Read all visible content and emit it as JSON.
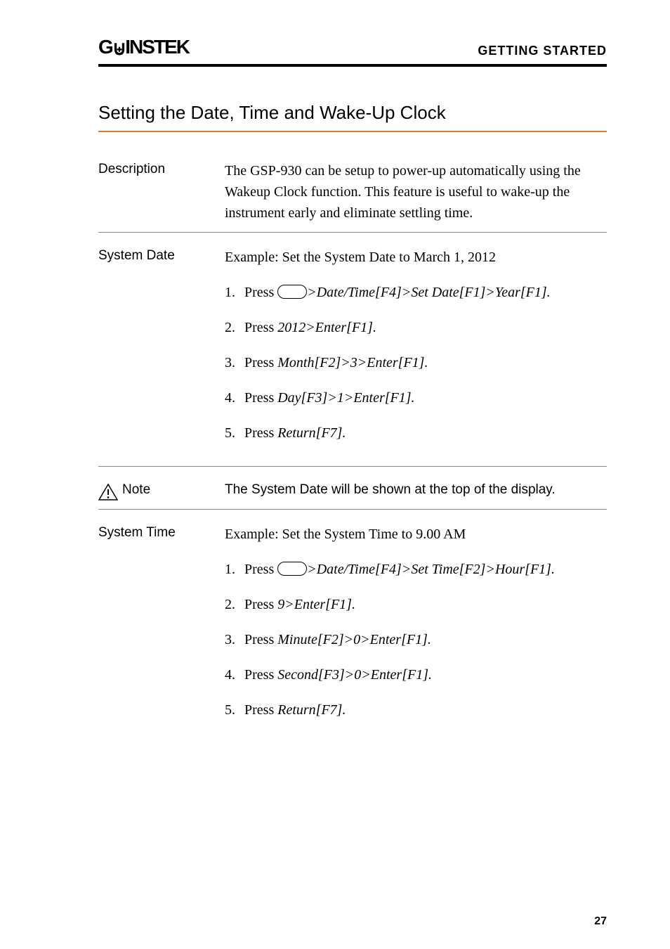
{
  "header": {
    "logo": "GWINSTEK",
    "right": "GETTING STARTED"
  },
  "section_title": "Setting the Date, Time and Wake-Up Clock",
  "description": {
    "label": "Description",
    "text": "The GSP-930 can be setup to power-up automatically using the Wakeup Clock function. This feature is useful to wake-up the instrument early and eliminate settling time."
  },
  "system_date": {
    "label": "System Date",
    "example": "Example: Set the System Date to March 1, 2012",
    "steps": [
      {
        "prefix": "Press ",
        "has_oval": true,
        "suffix1": ">Date/Time[F4]>Set Date[F1]>Year[F1]."
      },
      {
        "prefix": "Press ",
        "italic": "2012>Enter[F1]."
      },
      {
        "prefix": "Press ",
        "italic": "Month[F2]>3>Enter[F1]."
      },
      {
        "prefix": "Press ",
        "italic": "Day[F3]>1>Enter[F1]."
      },
      {
        "prefix": "Press ",
        "italic": "Return[F7]."
      }
    ]
  },
  "note": {
    "label": "Note",
    "text": "The System Date will be shown at the top of the display."
  },
  "system_time": {
    "label": "System Time",
    "example": "Example: Set the System Time to 9.00 AM",
    "steps": [
      {
        "prefix": "Press ",
        "has_oval": true,
        "suffix1": ">Date/Time[F4]>Set Time[F2]>Hour[F1]."
      },
      {
        "prefix": "Press ",
        "italic": "9>Enter[F1]."
      },
      {
        "prefix": "Press ",
        "italic": "Minute[F2]>0>Enter[F1]."
      },
      {
        "prefix": "Press ",
        "italic": "Second[F3]>0>Enter[F1]."
      },
      {
        "prefix": "Press ",
        "italic": "Return[F7]."
      }
    ]
  },
  "page_number": "27"
}
